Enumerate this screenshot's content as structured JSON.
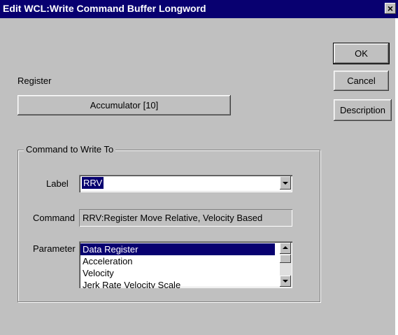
{
  "window": {
    "title": "Edit WCL:Write Command Buffer Longword",
    "close_glyph": "×"
  },
  "buttons": {
    "ok": "OK",
    "cancel": "Cancel",
    "description": "Description"
  },
  "register": {
    "label": "Register",
    "value": "Accumulator [10]"
  },
  "group": {
    "title": "Command to Write To"
  },
  "label_field": {
    "label": "Label",
    "value": "RRV"
  },
  "command_field": {
    "label": "Command",
    "value": "RRV:Register Move Relative, Velocity Based"
  },
  "parameter_field": {
    "label": "Parameter",
    "items": [
      "Data Register",
      "Acceleration",
      "Velocity",
      "Jerk Rate Velocity Scale"
    ],
    "selected_index": 0
  },
  "colors": {
    "title_bar": "#080070",
    "dialog_face": "#c0c0c0",
    "selection": "#080070"
  },
  "icons": {
    "dropdown": "chevron-down-icon",
    "scroll_up": "arrow-up-icon",
    "scroll_down": "arrow-down-icon"
  }
}
